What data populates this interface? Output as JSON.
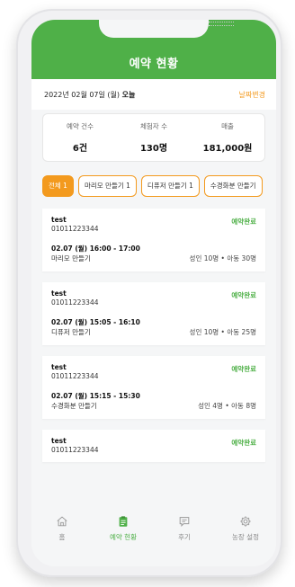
{
  "header": {
    "title": "예약 현황"
  },
  "date_bar": {
    "date": "2022년 02월 07일 (월)",
    "today": "오늘",
    "change": "날짜변경"
  },
  "stats": [
    {
      "label": "예약 건수",
      "value": "6건"
    },
    {
      "label": "체험자 수",
      "value": "130명"
    },
    {
      "label": "매출",
      "value": "181,000원"
    }
  ],
  "tabs": [
    {
      "label": "전체 1",
      "active": true
    },
    {
      "label": "마리모 만들기 1",
      "active": false
    },
    {
      "label": "디퓨저 만들기 1",
      "active": false
    },
    {
      "label": "수경화분 만들기",
      "active": false
    }
  ],
  "reservations": [
    {
      "name": "test",
      "phone": "01011223344",
      "status": "예약완료",
      "time": "02.07 (월) 16:00 - 17:00",
      "program": "마리모 만들기",
      "people": "성인 10명 • 아동 30명"
    },
    {
      "name": "test",
      "phone": "01011223344",
      "status": "예약완료",
      "time": "02.07 (월) 15:05 - 16:10",
      "program": "디퓨저 만들기",
      "people": "성인 10명 • 아동 25명"
    },
    {
      "name": "test",
      "phone": "01011223344",
      "status": "예약완료",
      "time": "02.07 (월) 15:15 - 15:30",
      "program": "수경화분 만들기",
      "people": "성인 4명 • 아동 8명"
    },
    {
      "name": "test",
      "phone": "01011223344",
      "status": "예약완료"
    }
  ],
  "nav": [
    {
      "label": "홈",
      "icon": "home-icon",
      "active": false
    },
    {
      "label": "예약 현황",
      "icon": "clipboard-icon",
      "active": true
    },
    {
      "label": "후기",
      "icon": "review-icon",
      "active": false
    },
    {
      "label": "농장 설정",
      "icon": "gear-icon",
      "active": false
    }
  ],
  "colors": {
    "brand_green": "#4fb048",
    "accent_orange": "#f39a1e"
  }
}
